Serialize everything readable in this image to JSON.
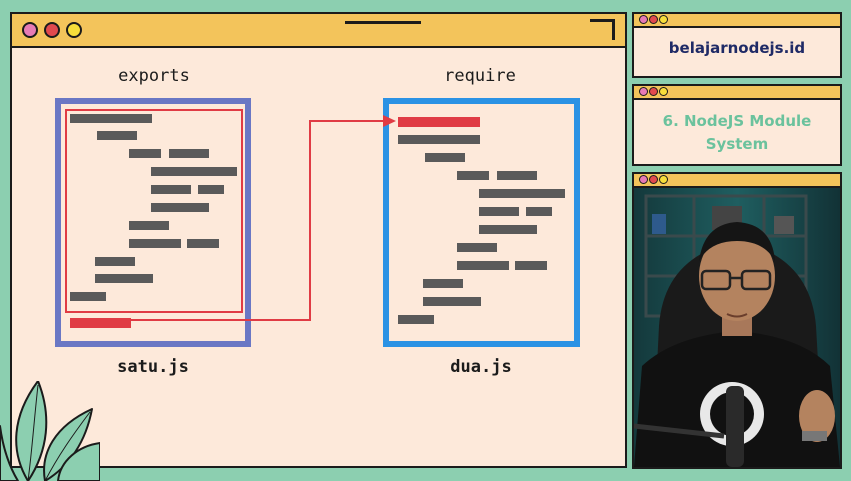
{
  "diagram": {
    "left_heading": "exports",
    "right_heading": "require",
    "left_file": "satu.js",
    "right_file": "dua.js"
  },
  "sidebar": {
    "site_title": "belajarnodejs.id",
    "lesson_title_line1": "6. NodeJS Module",
    "lesson_title_line2": "System"
  },
  "colors": {
    "background": "#8ccfb0",
    "window_fill": "#fde9da",
    "title_bar": "#f3c45b",
    "left_box": "#6a77c4",
    "right_box": "#2b92e4",
    "highlight": "#e03b44",
    "code_line": "#5a5a5a",
    "dot_pink": "#e77bb5",
    "dot_red": "#e14a4e",
    "dot_yellow": "#f7de3a",
    "lesson_text": "#6bc29d"
  }
}
